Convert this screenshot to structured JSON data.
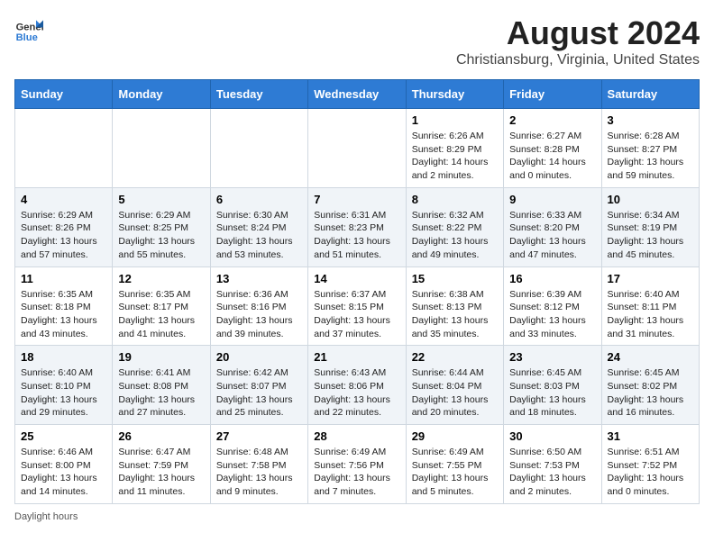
{
  "header": {
    "logo_line1": "General",
    "logo_line2": "Blue",
    "main_title": "August 2024",
    "subtitle": "Christiansburg, Virginia, United States"
  },
  "days_of_week": [
    "Sunday",
    "Monday",
    "Tuesday",
    "Wednesday",
    "Thursday",
    "Friday",
    "Saturday"
  ],
  "weeks": [
    [
      {
        "day": "",
        "info": ""
      },
      {
        "day": "",
        "info": ""
      },
      {
        "day": "",
        "info": ""
      },
      {
        "day": "",
        "info": ""
      },
      {
        "day": "1",
        "info": "Sunrise: 6:26 AM\nSunset: 8:29 PM\nDaylight: 14 hours\nand 2 minutes."
      },
      {
        "day": "2",
        "info": "Sunrise: 6:27 AM\nSunset: 8:28 PM\nDaylight: 14 hours\nand 0 minutes."
      },
      {
        "day": "3",
        "info": "Sunrise: 6:28 AM\nSunset: 8:27 PM\nDaylight: 13 hours\nand 59 minutes."
      }
    ],
    [
      {
        "day": "4",
        "info": "Sunrise: 6:29 AM\nSunset: 8:26 PM\nDaylight: 13 hours\nand 57 minutes."
      },
      {
        "day": "5",
        "info": "Sunrise: 6:29 AM\nSunset: 8:25 PM\nDaylight: 13 hours\nand 55 minutes."
      },
      {
        "day": "6",
        "info": "Sunrise: 6:30 AM\nSunset: 8:24 PM\nDaylight: 13 hours\nand 53 minutes."
      },
      {
        "day": "7",
        "info": "Sunrise: 6:31 AM\nSunset: 8:23 PM\nDaylight: 13 hours\nand 51 minutes."
      },
      {
        "day": "8",
        "info": "Sunrise: 6:32 AM\nSunset: 8:22 PM\nDaylight: 13 hours\nand 49 minutes."
      },
      {
        "day": "9",
        "info": "Sunrise: 6:33 AM\nSunset: 8:20 PM\nDaylight: 13 hours\nand 47 minutes."
      },
      {
        "day": "10",
        "info": "Sunrise: 6:34 AM\nSunset: 8:19 PM\nDaylight: 13 hours\nand 45 minutes."
      }
    ],
    [
      {
        "day": "11",
        "info": "Sunrise: 6:35 AM\nSunset: 8:18 PM\nDaylight: 13 hours\nand 43 minutes."
      },
      {
        "day": "12",
        "info": "Sunrise: 6:35 AM\nSunset: 8:17 PM\nDaylight: 13 hours\nand 41 minutes."
      },
      {
        "day": "13",
        "info": "Sunrise: 6:36 AM\nSunset: 8:16 PM\nDaylight: 13 hours\nand 39 minutes."
      },
      {
        "day": "14",
        "info": "Sunrise: 6:37 AM\nSunset: 8:15 PM\nDaylight: 13 hours\nand 37 minutes."
      },
      {
        "day": "15",
        "info": "Sunrise: 6:38 AM\nSunset: 8:13 PM\nDaylight: 13 hours\nand 35 minutes."
      },
      {
        "day": "16",
        "info": "Sunrise: 6:39 AM\nSunset: 8:12 PM\nDaylight: 13 hours\nand 33 minutes."
      },
      {
        "day": "17",
        "info": "Sunrise: 6:40 AM\nSunset: 8:11 PM\nDaylight: 13 hours\nand 31 minutes."
      }
    ],
    [
      {
        "day": "18",
        "info": "Sunrise: 6:40 AM\nSunset: 8:10 PM\nDaylight: 13 hours\nand 29 minutes."
      },
      {
        "day": "19",
        "info": "Sunrise: 6:41 AM\nSunset: 8:08 PM\nDaylight: 13 hours\nand 27 minutes."
      },
      {
        "day": "20",
        "info": "Sunrise: 6:42 AM\nSunset: 8:07 PM\nDaylight: 13 hours\nand 25 minutes."
      },
      {
        "day": "21",
        "info": "Sunrise: 6:43 AM\nSunset: 8:06 PM\nDaylight: 13 hours\nand 22 minutes."
      },
      {
        "day": "22",
        "info": "Sunrise: 6:44 AM\nSunset: 8:04 PM\nDaylight: 13 hours\nand 20 minutes."
      },
      {
        "day": "23",
        "info": "Sunrise: 6:45 AM\nSunset: 8:03 PM\nDaylight: 13 hours\nand 18 minutes."
      },
      {
        "day": "24",
        "info": "Sunrise: 6:45 AM\nSunset: 8:02 PM\nDaylight: 13 hours\nand 16 minutes."
      }
    ],
    [
      {
        "day": "25",
        "info": "Sunrise: 6:46 AM\nSunset: 8:00 PM\nDaylight: 13 hours\nand 14 minutes."
      },
      {
        "day": "26",
        "info": "Sunrise: 6:47 AM\nSunset: 7:59 PM\nDaylight: 13 hours\nand 11 minutes."
      },
      {
        "day": "27",
        "info": "Sunrise: 6:48 AM\nSunset: 7:58 PM\nDaylight: 13 hours\nand 9 minutes."
      },
      {
        "day": "28",
        "info": "Sunrise: 6:49 AM\nSunset: 7:56 PM\nDaylight: 13 hours\nand 7 minutes."
      },
      {
        "day": "29",
        "info": "Sunrise: 6:49 AM\nSunset: 7:55 PM\nDaylight: 13 hours\nand 5 minutes."
      },
      {
        "day": "30",
        "info": "Sunrise: 6:50 AM\nSunset: 7:53 PM\nDaylight: 13 hours\nand 2 minutes."
      },
      {
        "day": "31",
        "info": "Sunrise: 6:51 AM\nSunset: 7:52 PM\nDaylight: 13 hours\nand 0 minutes."
      }
    ]
  ],
  "footer": {
    "daylight_label": "Daylight hours"
  }
}
